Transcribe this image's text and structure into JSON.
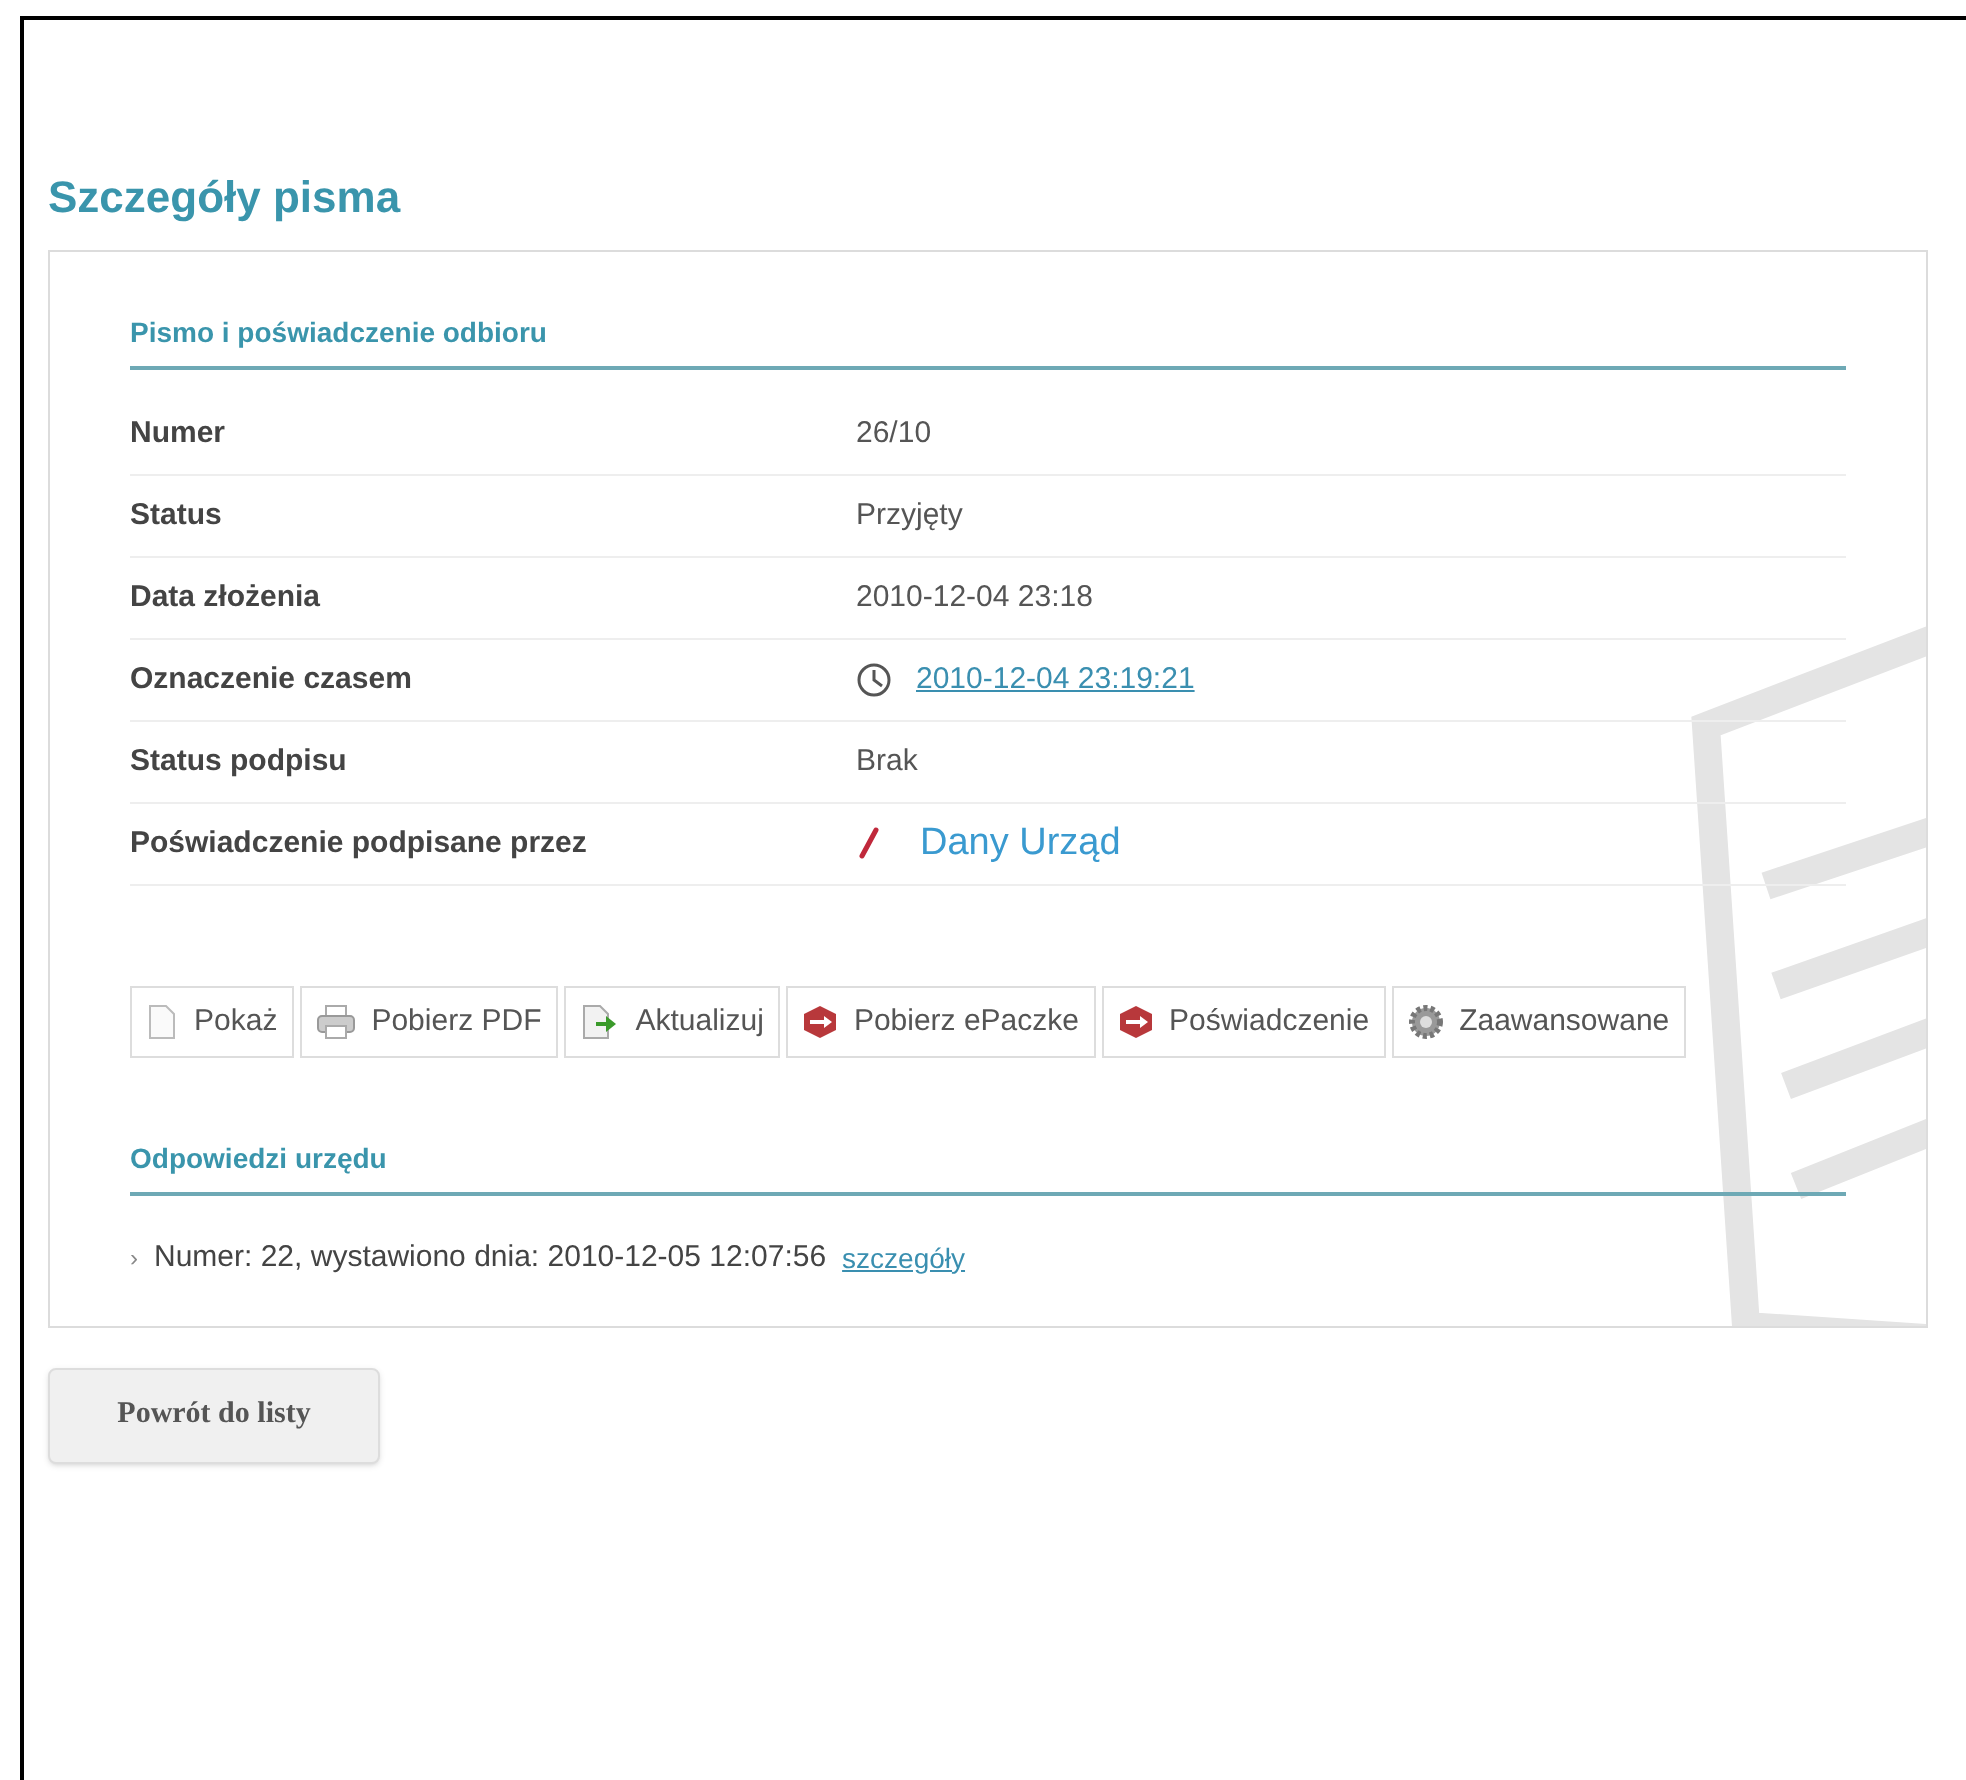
{
  "title": "Szczegóły pisma",
  "section": {
    "heading": "Pismo i poświadczenie odbioru",
    "rows": [
      {
        "label": "Numer",
        "value": "26/10",
        "kind": "text"
      },
      {
        "label": "Status",
        "value": "Przyjęty",
        "kind": "text"
      },
      {
        "label": "Data złożenia",
        "value": "2010-12-04 23:18",
        "kind": "text"
      },
      {
        "label": "Oznaczenie czasem",
        "value": "2010-12-04 23:19:21",
        "kind": "timestamp"
      },
      {
        "label": "Status podpisu",
        "value": "Brak",
        "kind": "text"
      },
      {
        "label": "Poświadczenie podpisane przez",
        "value": "Dany Urząd",
        "kind": "signer"
      }
    ]
  },
  "actions": [
    {
      "label": "Pokaż",
      "kind": "page"
    },
    {
      "label": "Pobierz PDF",
      "kind": "printer"
    },
    {
      "label": "Aktualizuj",
      "kind": "update"
    },
    {
      "label": "Pobierz ePaczke",
      "kind": "package"
    },
    {
      "label": "Poświadczenie",
      "kind": "package"
    },
    {
      "label": "Zaawansowane",
      "kind": "gear"
    }
  ],
  "responses": {
    "heading": "Odpowiedzi urzędu",
    "items": [
      {
        "marker": "›",
        "text": "Numer: 22, wystawiono dnia: 2010-12-05 12:07:56",
        "link": "szczegóły"
      }
    ]
  },
  "back_button": "Powrót do listy"
}
